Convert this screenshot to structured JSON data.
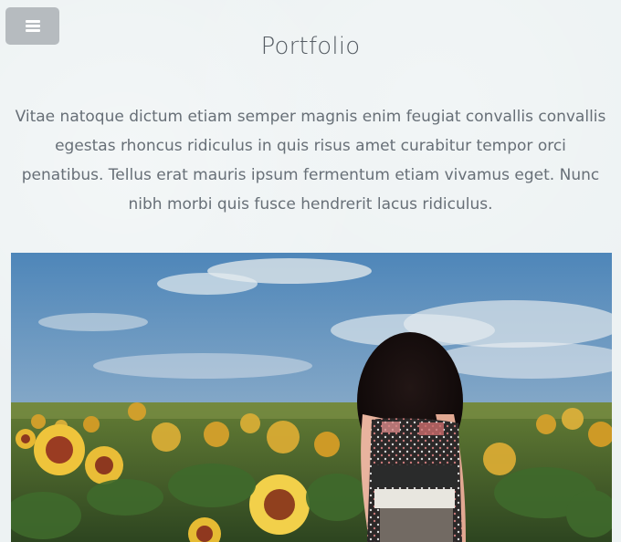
{
  "header": {
    "menu_icon": "hamburger-menu-icon",
    "title": "Portfolio"
  },
  "intro": {
    "text": "Vitae natoque dictum etiam semper magnis enim feugiat convallis convallis egestas rhoncus ridiculus in quis risus amet curabitur tempor orci penatibus. Tellus erat mauris ipsum fermentum etiam vivamus eget. Nunc nibh morbi quis fusce hendrerit lacus ridiculus."
  },
  "hero": {
    "image_subject": "woman with curly hair standing in a sunflower field under a blue sky"
  },
  "colors": {
    "button_bg": "#b6bbbf",
    "title_text": "#555c63",
    "body_text": "#676f77",
    "page_bg": "#edf2f3"
  }
}
